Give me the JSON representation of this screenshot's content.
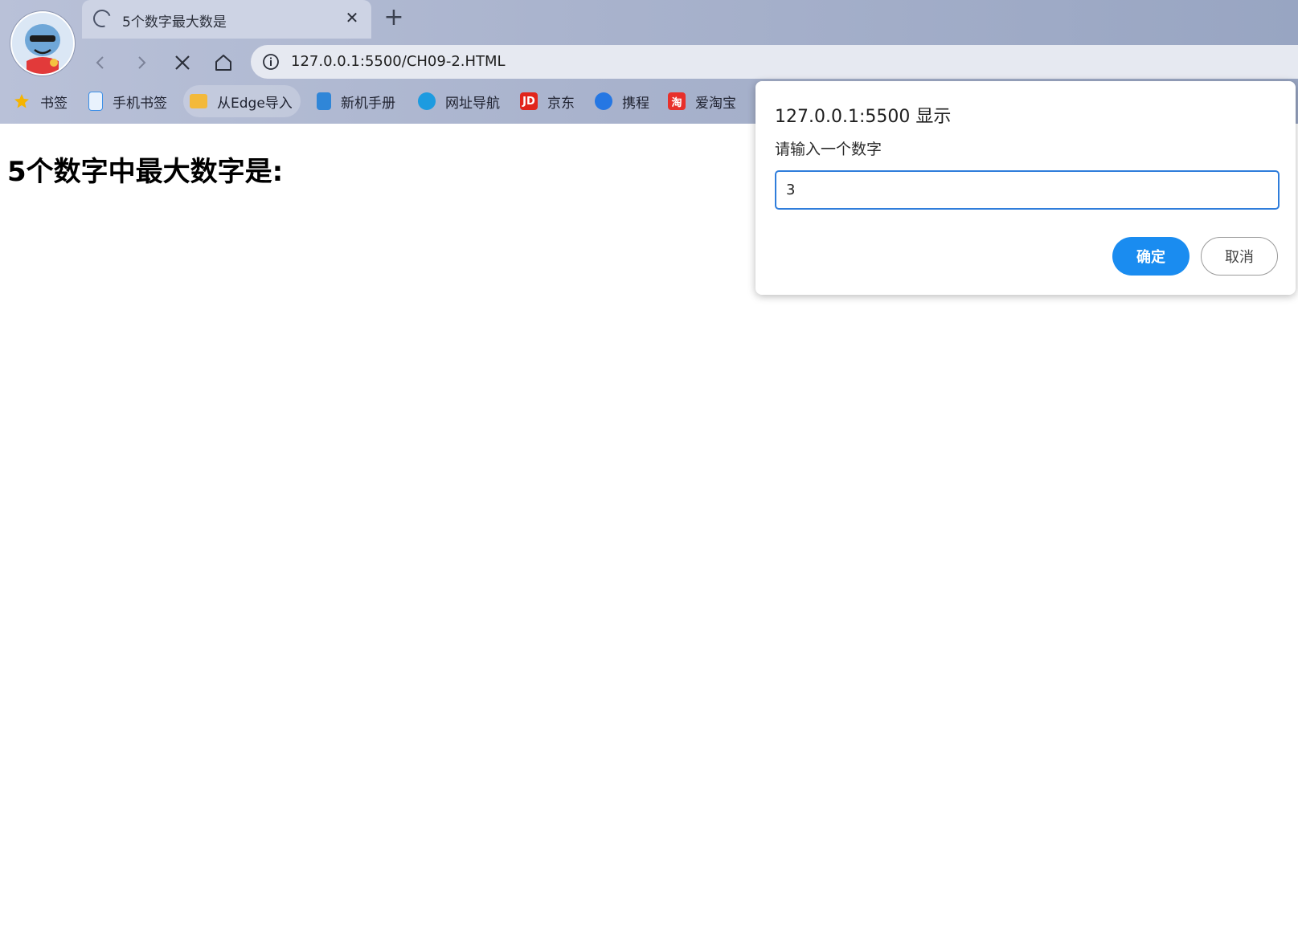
{
  "browser": {
    "tab": {
      "title": "5个数字最大数是",
      "close_glyph": "✕"
    },
    "new_tab_glyph": "+",
    "address": {
      "url": "127.0.0.1:5500/CH09-2.HTML"
    },
    "bookmarks": [
      {
        "label": "书签",
        "icon": "star-icon",
        "color": "#f5b400"
      },
      {
        "label": "手机书签",
        "icon": "phone-bookmark-icon",
        "color": "#3b8fe8"
      },
      {
        "label": "从Edge导入",
        "icon": "folder-icon",
        "color": "#f3b93a"
      },
      {
        "label": "新机手册",
        "icon": "manual-icon",
        "color": "#2f86d8"
      },
      {
        "label": "网址导航",
        "icon": "edge-icon",
        "color": "#1d9be0"
      },
      {
        "label": "京东",
        "icon": "jd-icon",
        "color": "#e1251b",
        "glyph": "JD"
      },
      {
        "label": "携程",
        "icon": "ctrip-icon",
        "color": "#2577e3"
      },
      {
        "label": "爱淘宝",
        "icon": "taobao-icon",
        "color": "#e8302b",
        "glyph": "淘"
      }
    ]
  },
  "page": {
    "heading": "5个数字中最大数字是:"
  },
  "dialog": {
    "title": "127.0.0.1:5500 显示",
    "message": "请输入一个数字",
    "input_value": "3",
    "ok_label": "确定",
    "cancel_label": "取消"
  }
}
